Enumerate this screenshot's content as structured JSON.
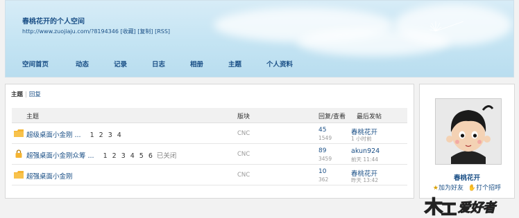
{
  "header": {
    "title": "春桃花开的个人空间",
    "url": "http://www.zuojiaju.com/?8194346",
    "links": [
      "[收藏]",
      "[复制]",
      "[RSS]"
    ]
  },
  "nav": [
    "空间首页",
    "动态",
    "记录",
    "日志",
    "相册",
    "主题",
    "个人资料"
  ],
  "tabs": {
    "active": "主题",
    "other": "回复"
  },
  "table": {
    "headers": {
      "subject": "主题",
      "board": "版块",
      "replies_views": "回复/查看",
      "last_post": "最后发帖"
    },
    "rows": [
      {
        "title": "超级桌面小金刚 ...",
        "pages": [
          "1",
          "2",
          "3",
          "4"
        ],
        "closed": "",
        "board": "CNC",
        "replies": "45",
        "views": "1549",
        "last_user": "春桃花开",
        "last_time": "1 小时前",
        "icon": "folder-icon"
      },
      {
        "title": "超强桌面小金刚众筹 ...",
        "pages": [
          "1",
          "2",
          "3",
          "4",
          "5",
          "6"
        ],
        "closed": "已关闭",
        "board": "CNC",
        "replies": "89",
        "views": "3459",
        "last_user": "akun924",
        "last_time": "前天 11:44",
        "icon": "lock-icon"
      },
      {
        "title": "超强桌面小金刚",
        "pages": [],
        "closed": "",
        "board": "CNC",
        "replies": "10",
        "views": "362",
        "last_user": "春桃花开",
        "last_time": "昨天 13:42",
        "icon": "folder-icon"
      }
    ]
  },
  "profile": {
    "username": "春桃花开",
    "add_friend": "加为好友",
    "greet": "打个招呼"
  },
  "badge": {
    "text": "木工爱好者"
  },
  "colors": {
    "link": "#1a4f86",
    "header_bg": "#c4e4f3",
    "folder": "#f5b431",
    "badge": "#f7c800"
  }
}
